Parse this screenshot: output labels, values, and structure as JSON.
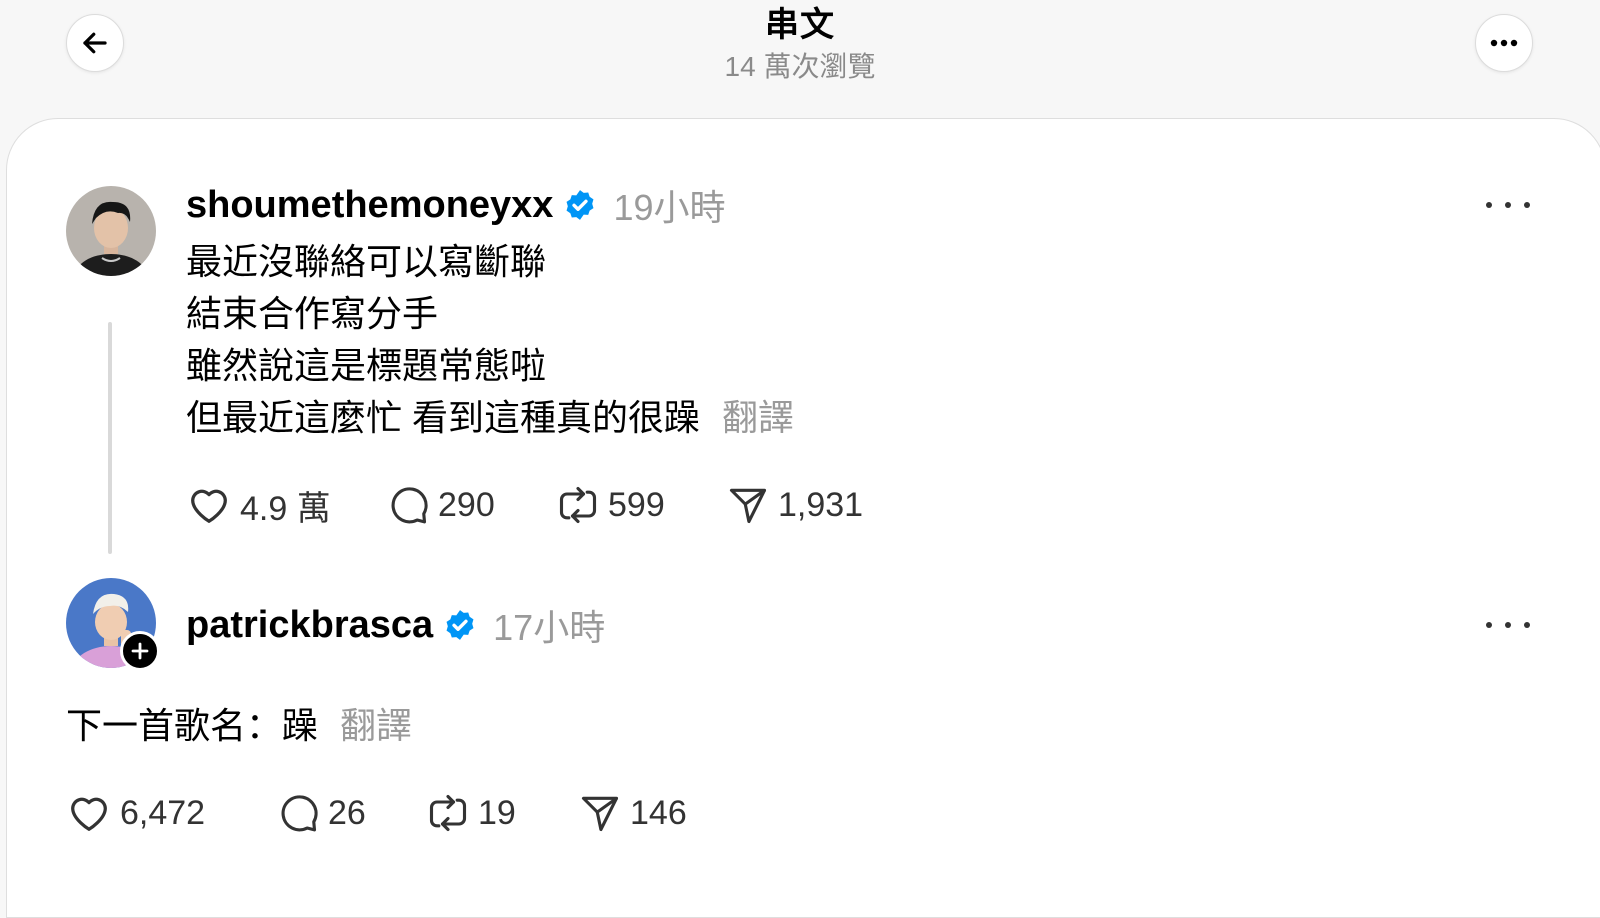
{
  "header": {
    "title": "串文",
    "views": "14 萬次瀏覽",
    "back_icon": "arrow-left-icon",
    "more_icon": "ellipsis-icon"
  },
  "posts": [
    {
      "username": "shoumethemoneyxx",
      "verified": true,
      "time": "19小時",
      "lines": [
        "最近沒聯絡可以寫斷聯",
        "結束合作寫分手",
        "雖然說這是標題常態啦",
        "但最近這麼忙 看到這種真的很躁"
      ],
      "translate": "翻譯",
      "likes": "4.9 萬",
      "replies": "290",
      "reposts": "599",
      "shares": "1,931"
    },
    {
      "username": "patrickbrasca",
      "verified": true,
      "time": "17小時",
      "lines": [
        "下一首歌名：躁"
      ],
      "translate": "翻譯",
      "likes": "6,472",
      "replies": "26",
      "reposts": "19",
      "shares": "146"
    }
  ],
  "colors": {
    "verified": "#0095f6",
    "muted": "#9a9a9a",
    "line": "#d9d9d9"
  }
}
